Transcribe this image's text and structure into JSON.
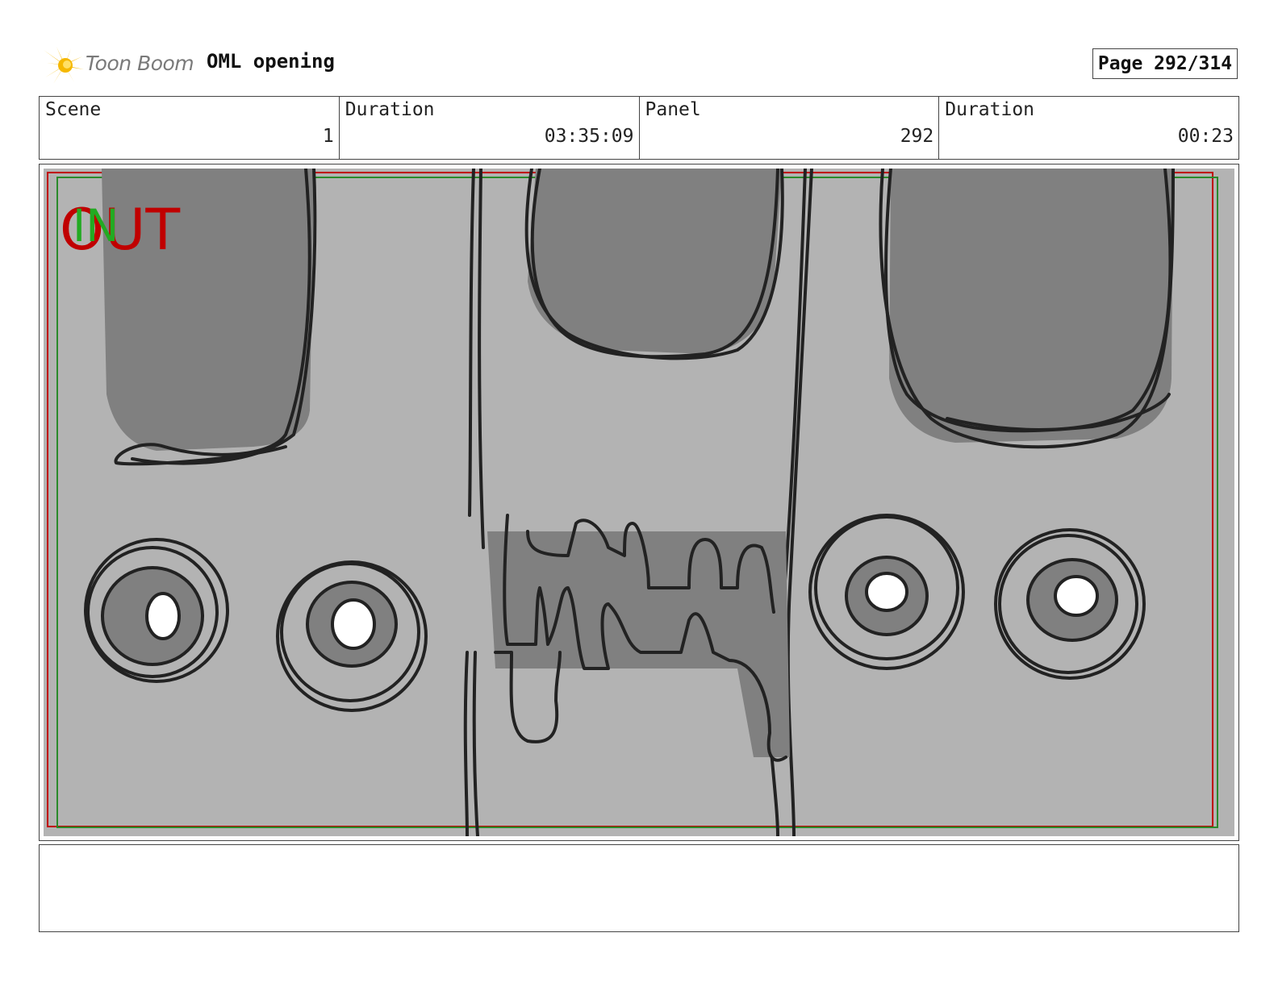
{
  "header": {
    "logo_text": "Toon Boom",
    "project_title": "OML opening",
    "page_label": "Page 292/314"
  },
  "info": {
    "scene_label": "Scene",
    "scene_value": "1",
    "duration_label": "Duration",
    "duration_value": "03:35:09",
    "panel_label": "Panel",
    "panel_value": "292",
    "panel_duration_label": "Duration",
    "panel_duration_value": "00:23"
  },
  "panel": {
    "out_label": "OUT",
    "in_label": "IN"
  },
  "notes": {
    "text": ""
  },
  "colors": {
    "logo_burst": "#f5b800",
    "out_mark": "#c00000",
    "in_mark": "#22aa22",
    "safe_frame_red": "#c00000",
    "safe_frame_green": "#2a8a2a",
    "background_gray": "#b3b3b3",
    "shade_gray": "#808080"
  }
}
